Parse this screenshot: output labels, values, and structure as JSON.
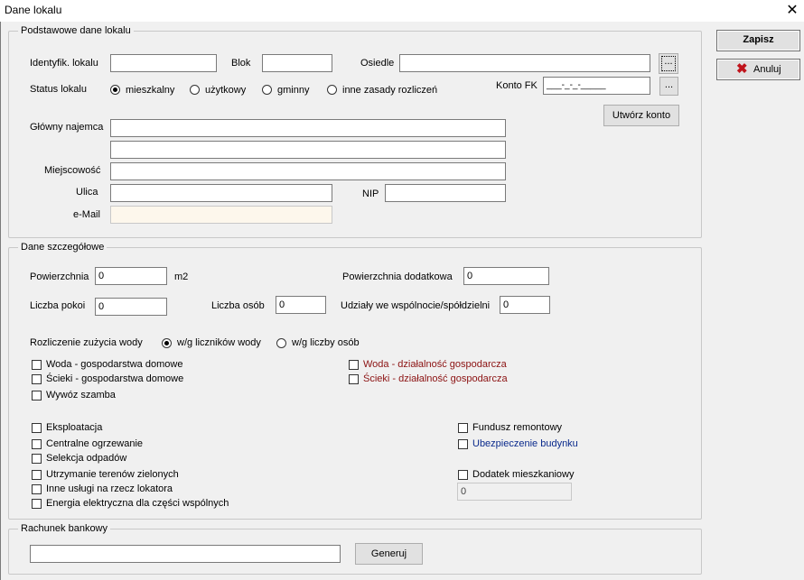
{
  "window": {
    "title": "Dane lokalu",
    "close_glyph": "✕"
  },
  "buttons": {
    "save": "Zapisz",
    "cancel": "Anuluj",
    "create_account": "Utwórz konto",
    "generate": "Generuj",
    "browse": "...",
    "konto_browse": "..."
  },
  "basic": {
    "legend": "Podstawowe dane lokalu",
    "id_label": "Identyfik. lokalu",
    "id_value": "",
    "blok_label": "Blok",
    "blok_value": "",
    "osiedle_label": "Osiedle",
    "osiedle_value": "",
    "status_label": "Status lokalu",
    "status_options": [
      "mieszkalny",
      "użytkowy",
      "gminny",
      "inne zasady rozliczeń"
    ],
    "konto_label": "Konto FK",
    "konto_mask": "___-_-_-_____",
    "tenant_label": "Główny najemca",
    "tenant_value": "",
    "tenant_value2": "",
    "city_label": "Miejscowość",
    "city_value": "",
    "street_label": "Ulica",
    "street_value": "",
    "nip_label": "NIP",
    "nip_value": "",
    "email_label": "e-Mail",
    "email_value": ""
  },
  "details": {
    "legend": "Dane szczegółowe",
    "area_label": "Powierzchnia",
    "area_value": "0",
    "area_unit": "m2",
    "extra_area_label": "Powierzchnia dodatkowa",
    "extra_area_value": "0",
    "rooms_label": "Liczba pokoi",
    "rooms_value": "0",
    "persons_label": "Liczba osób",
    "persons_value": "0",
    "shares_label": "Udziały we wspólnocie/spółdzielni",
    "shares_value": "0",
    "water_label": "Rozliczenie zużycia wody",
    "water_options": [
      "w/g liczników wody",
      "w/g liczby osób"
    ],
    "checks_left_a": [
      "Woda - gospodarstwa domowe",
      "Ścieki - gospodarstwa domowe",
      "Wywóz szamba"
    ],
    "checks_right_a": [
      "Woda - działalność gospodarcza",
      "Ścieki - działalność gospodarcza"
    ],
    "checks_left_b": [
      "Eksploatacja",
      "Centralne ogrzewanie",
      "Selekcja odpadów",
      "Utrzymanie terenów zielonych",
      "Inne usługi na rzecz lokatora",
      "Energia elektryczna dla części wspólnych"
    ],
    "checks_right_b": [
      "Fundusz remontowy",
      "Ubezpieczenie budynku",
      "Dodatek mieszkaniowy"
    ],
    "housing_allowance_value": "0"
  },
  "bank": {
    "legend": "Rachunek bankowy",
    "account_value": ""
  },
  "colors": {
    "red_text": "#8b1111",
    "blue_text": "#0a2a8c",
    "cancel_icon": "#c0141c"
  }
}
